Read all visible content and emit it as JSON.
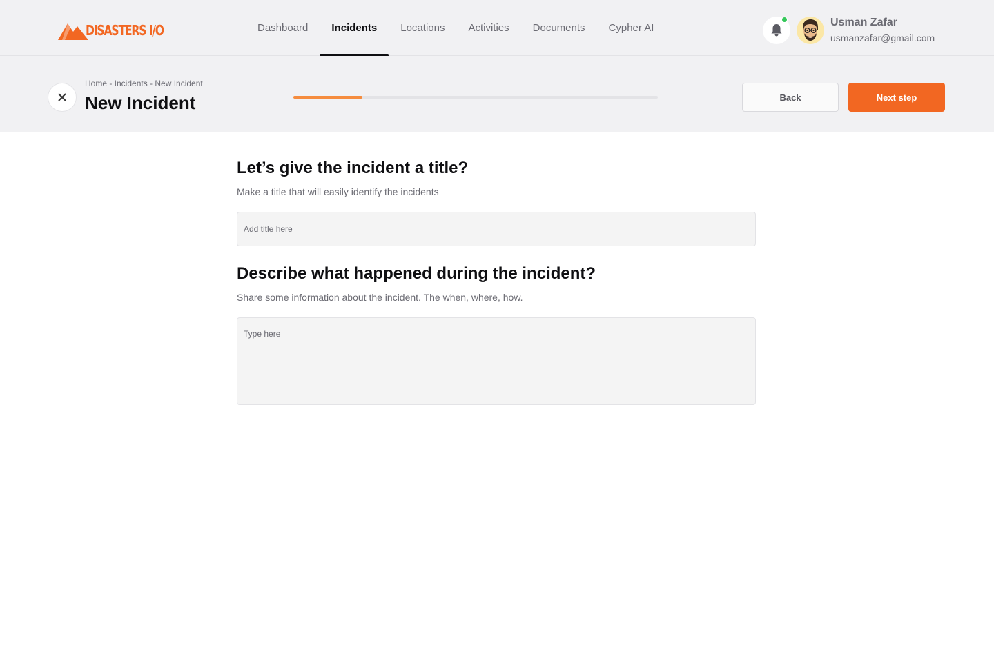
{
  "brand": {
    "name": "DISASTERS I/O",
    "color": "#f26722"
  },
  "nav": {
    "items": [
      {
        "label": "Dashboard",
        "active": false
      },
      {
        "label": "Incidents",
        "active": true
      },
      {
        "label": "Locations",
        "active": false
      },
      {
        "label": "Activities",
        "active": false
      },
      {
        "label": "Documents",
        "active": false
      },
      {
        "label": "Cypher AI",
        "active": false
      }
    ]
  },
  "notifications": {
    "icon": "bell-icon",
    "status_color": "#34c759"
  },
  "user": {
    "name": "Usman Zafar",
    "email": "usmanzafar@gmail.com",
    "avatar_icon": "avatar-icon"
  },
  "header": {
    "close_icon": "close-icon",
    "breadcrumb": "Home - Incidents - New Incident",
    "title": "New Incident",
    "progress": 0.19,
    "back_label": "Back",
    "next_label": "Next step"
  },
  "form": {
    "title_question": "Let’s give the incident a title?",
    "title_hint": "Make a title that will easily identify the incidents",
    "title_placeholder": "Add title here",
    "title_value": "",
    "desc_question": "Describe what happened during the incident?",
    "desc_hint": "Share some information about the incident. The when, where, how.",
    "desc_placeholder": "Type here",
    "desc_value": ""
  }
}
